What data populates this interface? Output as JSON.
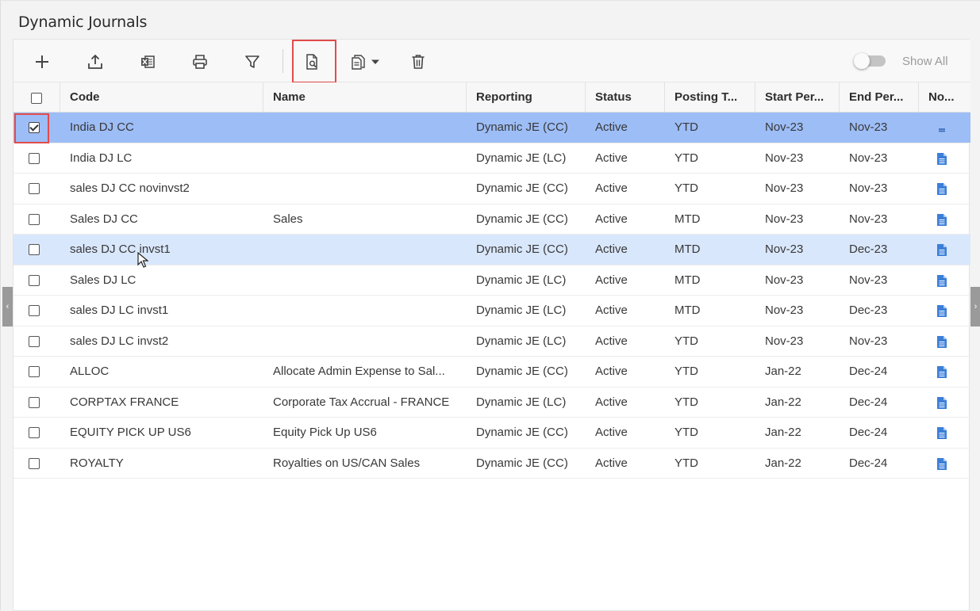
{
  "page": {
    "title": "Dynamic Journals"
  },
  "toolbar": {
    "buttons": [
      {
        "name": "add-button",
        "icon": "plus-icon"
      },
      {
        "name": "upload-button",
        "icon": "upload-icon"
      },
      {
        "name": "export-excel-button",
        "icon": "excel-icon"
      },
      {
        "name": "print-button",
        "icon": "printer-icon"
      },
      {
        "name": "filter-button",
        "icon": "funnel-icon"
      },
      {
        "name": "preview-button",
        "icon": "document-search-icon"
      },
      {
        "name": "copy-menu-button",
        "icon": "copy-document-icon"
      },
      {
        "name": "delete-button",
        "icon": "trash-icon"
      }
    ],
    "show_all_label": "Show All",
    "show_all_enabled": false
  },
  "grid": {
    "columns": [
      "Code",
      "Name",
      "Reporting",
      "Status",
      "Posting T...",
      "Start Per...",
      "End Per...",
      "No..."
    ],
    "rows": [
      {
        "code": "India DJ CC",
        "name": "",
        "reporting": "Dynamic JE (CC)",
        "status": "Active",
        "posting": "YTD",
        "start": "Nov-23",
        "end": "Nov-23",
        "checked": true,
        "state": "selected"
      },
      {
        "code": "India DJ LC",
        "name": "",
        "reporting": "Dynamic JE (LC)",
        "status": "Active",
        "posting": "YTD",
        "start": "Nov-23",
        "end": "Nov-23",
        "checked": false,
        "state": ""
      },
      {
        "code": "sales DJ CC novinvst2",
        "name": "",
        "reporting": "Dynamic JE (CC)",
        "status": "Active",
        "posting": "YTD",
        "start": "Nov-23",
        "end": "Nov-23",
        "checked": false,
        "state": ""
      },
      {
        "code": "Sales DJ CC",
        "name": "Sales",
        "reporting": "Dynamic JE (CC)",
        "status": "Active",
        "posting": "MTD",
        "start": "Nov-23",
        "end": "Nov-23",
        "checked": false,
        "state": ""
      },
      {
        "code": "sales DJ CC invst1",
        "name": "",
        "reporting": "Dynamic JE (CC)",
        "status": "Active",
        "posting": "MTD",
        "start": "Nov-23",
        "end": "Dec-23",
        "checked": false,
        "state": "hover"
      },
      {
        "code": "Sales DJ LC",
        "name": "",
        "reporting": "Dynamic JE (LC)",
        "status": "Active",
        "posting": "MTD",
        "start": "Nov-23",
        "end": "Nov-23",
        "checked": false,
        "state": ""
      },
      {
        "code": "sales DJ LC invst1",
        "name": "",
        "reporting": "Dynamic JE (LC)",
        "status": "Active",
        "posting": "MTD",
        "start": "Nov-23",
        "end": "Dec-23",
        "checked": false,
        "state": ""
      },
      {
        "code": "sales DJ LC invst2",
        "name": "",
        "reporting": "Dynamic JE (LC)",
        "status": "Active",
        "posting": "YTD",
        "start": "Nov-23",
        "end": "Nov-23",
        "checked": false,
        "state": ""
      },
      {
        "code": "ALLOC",
        "name": "Allocate Admin Expense to Sal...",
        "reporting": "Dynamic JE (CC)",
        "status": "Active",
        "posting": "YTD",
        "start": "Jan-22",
        "end": "Dec-24",
        "checked": false,
        "state": ""
      },
      {
        "code": "CORPTAX FRANCE",
        "name": "Corporate Tax Accrual - FRANCE",
        "reporting": "Dynamic JE (LC)",
        "status": "Active",
        "posting": "YTD",
        "start": "Jan-22",
        "end": "Dec-24",
        "checked": false,
        "state": ""
      },
      {
        "code": "EQUITY PICK UP US6",
        "name": "Equity Pick Up US6",
        "reporting": "Dynamic JE (CC)",
        "status": "Active",
        "posting": "YTD",
        "start": "Jan-22",
        "end": "Dec-24",
        "checked": false,
        "state": ""
      },
      {
        "code": "ROYALTY",
        "name": "Royalties on US/CAN Sales",
        "reporting": "Dynamic JE (CC)",
        "status": "Active",
        "posting": "YTD",
        "start": "Jan-22",
        "end": "Dec-24",
        "checked": false,
        "state": ""
      }
    ]
  },
  "colors": {
    "selected_row": "#9dbdf6",
    "hover_row": "#d9e7fc",
    "highlight": "#e24b4b",
    "note_icon": "#3b7fd9"
  }
}
